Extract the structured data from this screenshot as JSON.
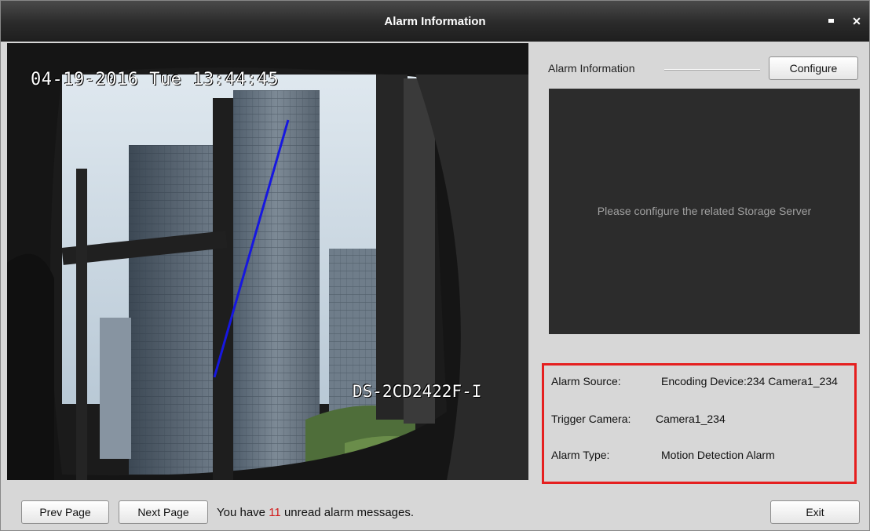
{
  "window": {
    "title": "Alarm Information",
    "maximize_icon": "maximize-icon",
    "close_icon": "close-icon"
  },
  "video": {
    "timestamp": "04-19-2016 Tue 13:44:45",
    "device_model": "DS-2CD2422F-I",
    "rule_line_color": "#1717e0"
  },
  "panel": {
    "section_label": "Alarm Information",
    "configure_label": "Configure",
    "playback_message": "Please configure the related Storage Server"
  },
  "alarm": {
    "source_label": "Alarm Source:",
    "source_value": "Encoding Device:234 Camera1_234",
    "camera_label": "Trigger Camera:",
    "camera_value": "Camera1_234",
    "type_label": "Alarm Type:",
    "type_value": "Motion Detection Alarm",
    "highlight_color": "#e51f1f"
  },
  "footer": {
    "prev_label": "Prev Page",
    "next_label": "Next Page",
    "unread_prefix": "You have",
    "unread_count": "11",
    "unread_suffix": "unread alarm messages.",
    "exit_label": "Exit"
  }
}
